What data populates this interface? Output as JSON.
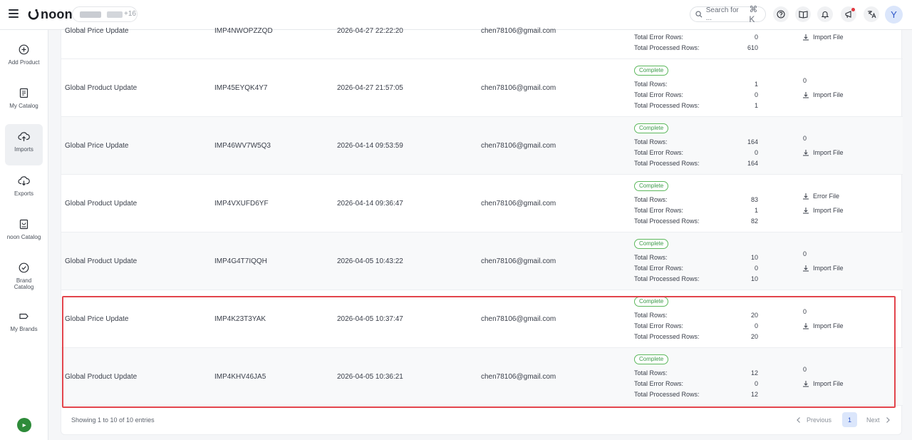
{
  "header": {
    "logo_text": "noon",
    "store_name_tail": "+16",
    "search_placeholder": "Search for ...",
    "search_shortcut": "⌘ K",
    "avatar_initial": "Y"
  },
  "sidebar": {
    "items": [
      {
        "label": "Add Product",
        "icon": "plus-circle-icon"
      },
      {
        "label": "My Catalog",
        "icon": "catalog-icon"
      },
      {
        "label": "Imports",
        "icon": "cloud-upload-icon",
        "active": true
      },
      {
        "label": "Exports",
        "icon": "cloud-download-icon"
      },
      {
        "label": "noon Catalog",
        "icon": "book-icon"
      },
      {
        "label": "Brand Catalog",
        "icon": "badge-check-icon"
      },
      {
        "label": "My Brands",
        "icon": "tag-icon"
      }
    ]
  },
  "table": {
    "labels": {
      "total_rows": "Total Rows:",
      "total_error_rows": "Total Error Rows:",
      "total_processed_rows": "Total Processed Rows:",
      "import_file": "Import File",
      "error_file": "Error File"
    },
    "partial_row": {
      "type": "Global Price Update",
      "id": "IMP4NWOPZZQD",
      "date": "2026-04-27 22:22:20",
      "email": "chen78106@gmail.com",
      "error_rows": "0",
      "processed_rows": "610"
    },
    "rows": [
      {
        "type": "Global Product Update",
        "id": "IMP45EYQK4Y7",
        "date": "2026-04-27 21:57:05",
        "email": "chen78106@gmail.com",
        "status": "Complete",
        "total_rows": "1",
        "error_rows": "0",
        "processed_rows": "1",
        "error_count": "0",
        "has_error_file": false
      },
      {
        "type": "Global Price Update",
        "id": "IMP46WV7W5Q3",
        "date": "2026-04-14 09:53:59",
        "email": "chen78106@gmail.com",
        "status": "Complete",
        "total_rows": "164",
        "error_rows": "0",
        "processed_rows": "164",
        "error_count": "0",
        "has_error_file": false
      },
      {
        "type": "Global Product Update",
        "id": "IMP4VXUFD6YF",
        "date": "2026-04-14 09:36:47",
        "email": "chen78106@gmail.com",
        "status": "Complete",
        "total_rows": "83",
        "error_rows": "1",
        "processed_rows": "82",
        "error_count": "",
        "has_error_file": true
      },
      {
        "type": "Global Product Update",
        "id": "IMP4G4T7IQQH",
        "date": "2026-04-05 10:43:22",
        "email": "chen78106@gmail.com",
        "status": "Complete",
        "total_rows": "10",
        "error_rows": "0",
        "processed_rows": "10",
        "error_count": "0",
        "has_error_file": false
      },
      {
        "type": "Global Price Update",
        "id": "IMP4K23T3YAK",
        "date": "2026-04-05 10:37:47",
        "email": "chen78106@gmail.com",
        "status": "Complete",
        "total_rows": "20",
        "error_rows": "0",
        "processed_rows": "20",
        "error_count": "0",
        "has_error_file": false
      },
      {
        "type": "Global Product Update",
        "id": "IMP4KHV46JA5",
        "date": "2026-04-05 10:36:21",
        "email": "chen78106@gmail.com",
        "status": "Complete",
        "total_rows": "12",
        "error_rows": "0",
        "processed_rows": "12",
        "error_count": "0",
        "has_error_file": false
      }
    ]
  },
  "footer": {
    "entries_text": "Showing 1 to 10 of 10 entries",
    "prev_label": "Previous",
    "current_page": "1",
    "next_label": "Next"
  },
  "colors": {
    "status_complete": "#3b9a48",
    "highlight": "#e2454c",
    "accent": "#2d56c8"
  }
}
